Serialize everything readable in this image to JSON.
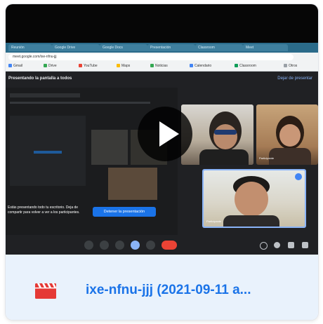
{
  "video": {
    "file_name": "ixe-nfnu-jjj (2021-09-11 a...",
    "icon": "film-clapper-icon",
    "play_icon": "play-icon",
    "accent_color": "#1a73e8",
    "icon_color": "#e53935"
  },
  "recording": {
    "meeting_title": "Presentando la pantalla a todos",
    "stop_present_label": "Dejar de presentar",
    "present_button_label": "Detener la presentación",
    "present_text": "Estás presentando todo tu escritorio. Deja de compartir para volver a ver a los participantes.",
    "url_text": "meet.google.com/ixe-nfnu-jjj",
    "tabs": [
      "Reunión",
      "Google Drive",
      "Google Docs",
      "Presentación",
      "Classroom",
      "Meet"
    ],
    "bookmarks": [
      "Gmail",
      "Drive",
      "YouTube",
      "Maps",
      "Noticias",
      "Calendario",
      "Classroom",
      "Otros"
    ],
    "tile_labels": [
      "Participante",
      "Participante"
    ]
  }
}
